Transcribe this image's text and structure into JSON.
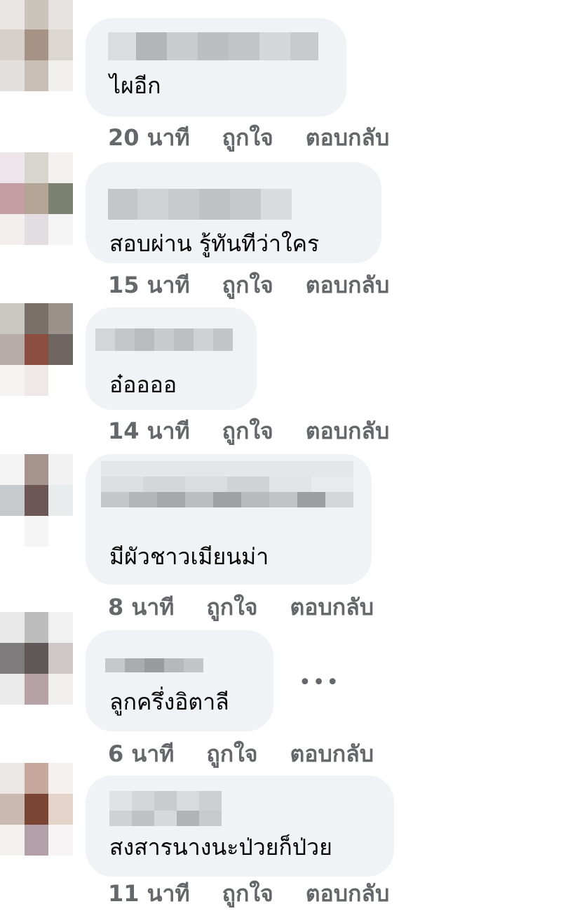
{
  "actions": {
    "like": "ถูกใจ",
    "reply": "ตอบกลับ"
  },
  "colors": {
    "bubble": "#f0f2f5",
    "meta_text": "#65676b",
    "comment_text": "#050505"
  },
  "icons": {
    "more": "more-options-icon"
  },
  "comments": [
    {
      "text": "ไผอีก",
      "time": "20 นาที"
    },
    {
      "text": "สอบผ่าน รู้ทันทีว่าใคร",
      "time": "15 นาที"
    },
    {
      "text": "อ๋ออออ",
      "time": "14 นาที"
    },
    {
      "text": "มีผัวชาวเมียนม่า",
      "time": "8 นาที"
    },
    {
      "text": "ลูกครึ่งอิตาลี",
      "time": "6 นาที"
    },
    {
      "text": "สงสารนางนะป่วยก็ป่วย",
      "time": "11 นาที"
    }
  ]
}
